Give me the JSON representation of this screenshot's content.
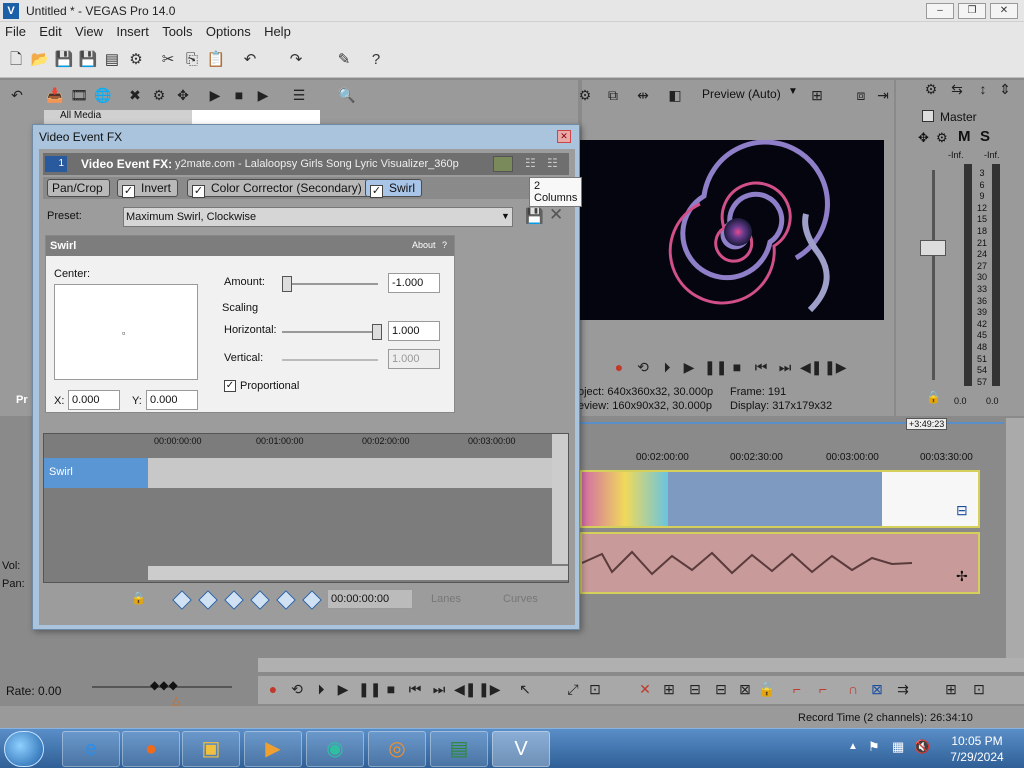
{
  "window": {
    "title": "Untitled * - VEGAS Pro 14.0",
    "logo": "V",
    "controls": {
      "minimize": "–",
      "maximize": "❐",
      "close": "✕"
    }
  },
  "menu": [
    "File",
    "Edit",
    "View",
    "Insert",
    "Tools",
    "Options",
    "Help"
  ],
  "explorer": {
    "tab": "All Media",
    "stub_label": "Pr"
  },
  "dialog": {
    "title": "Video Event FX",
    "header_num": "1",
    "header_label": "Video Event FX:",
    "header_media": "y2mate.com - Lalaloopsy Girls Song Lyric Visualizer_360p",
    "tooltip": "2 Columns",
    "chain": [
      {
        "label": "Pan/Crop",
        "checked": false
      },
      {
        "label": "Invert",
        "checked": true
      },
      {
        "label": "Color Corrector (Secondary)",
        "checked": true
      },
      {
        "label": "Swirl",
        "checked": true
      }
    ],
    "preset_label": "Preset:",
    "preset_value": "Maximum Swirl, Clockwise",
    "swirl": {
      "title": "Swirl",
      "about": "About",
      "help": "?",
      "center_label": "Center:",
      "x_label": "X:",
      "x_value": "0.000",
      "y_label": "Y:",
      "y_value": "0.000",
      "amount_label": "Amount:",
      "amount_value": "-1.000",
      "scaling_label": "Scaling",
      "horizontal_label": "Horizontal:",
      "horizontal_value": "1.000",
      "vertical_label": "Vertical:",
      "vertical_value": "1.000",
      "proportional_label": "Proportional",
      "proportional_checked": true
    },
    "keyframes": {
      "ruler": [
        "00:00:00:00",
        "00:01:00:00",
        "00:02:00:00",
        "00:03:00:00"
      ],
      "track_label": "Swirl",
      "time_value": "00:00:00:00",
      "lanes_label": "Lanes",
      "curves_label": "Curves"
    }
  },
  "preview": {
    "mode": "Preview (Auto)",
    "project_label": "oject:",
    "project_value": "640x360x32, 30.000p",
    "preview_label": "eview:",
    "preview_value": "160x90x32, 30.000p",
    "frame_label": "Frame:",
    "frame_value": "191",
    "display_label": "Display:",
    "display_value": "317x179x32"
  },
  "master": {
    "title": "Master",
    "inf_left": "-Inf.",
    "inf_right": "-Inf.",
    "scale": [
      "3",
      "6",
      "9",
      "12",
      "15",
      "18",
      "21",
      "24",
      "27",
      "30",
      "33",
      "36",
      "39",
      "42",
      "45",
      "48",
      "51",
      "54",
      "57"
    ],
    "value_left": "0.0",
    "value_right": "0.0",
    "mute": "M",
    "solo": "S"
  },
  "timeline": {
    "ruler": [
      "00:02:00:00",
      "00:02:30:00",
      "00:03:00:00",
      "00:03:30:00"
    ],
    "marker": "+3:49:23",
    "vol_label": "Vol:",
    "pan_label": "Pan:",
    "rate_label": "Rate: 0.00"
  },
  "status": {
    "record_time": "Record Time (2 channels): 26:34:10"
  },
  "clock": {
    "time": "10:05 PM",
    "date": "7/29/2024"
  }
}
